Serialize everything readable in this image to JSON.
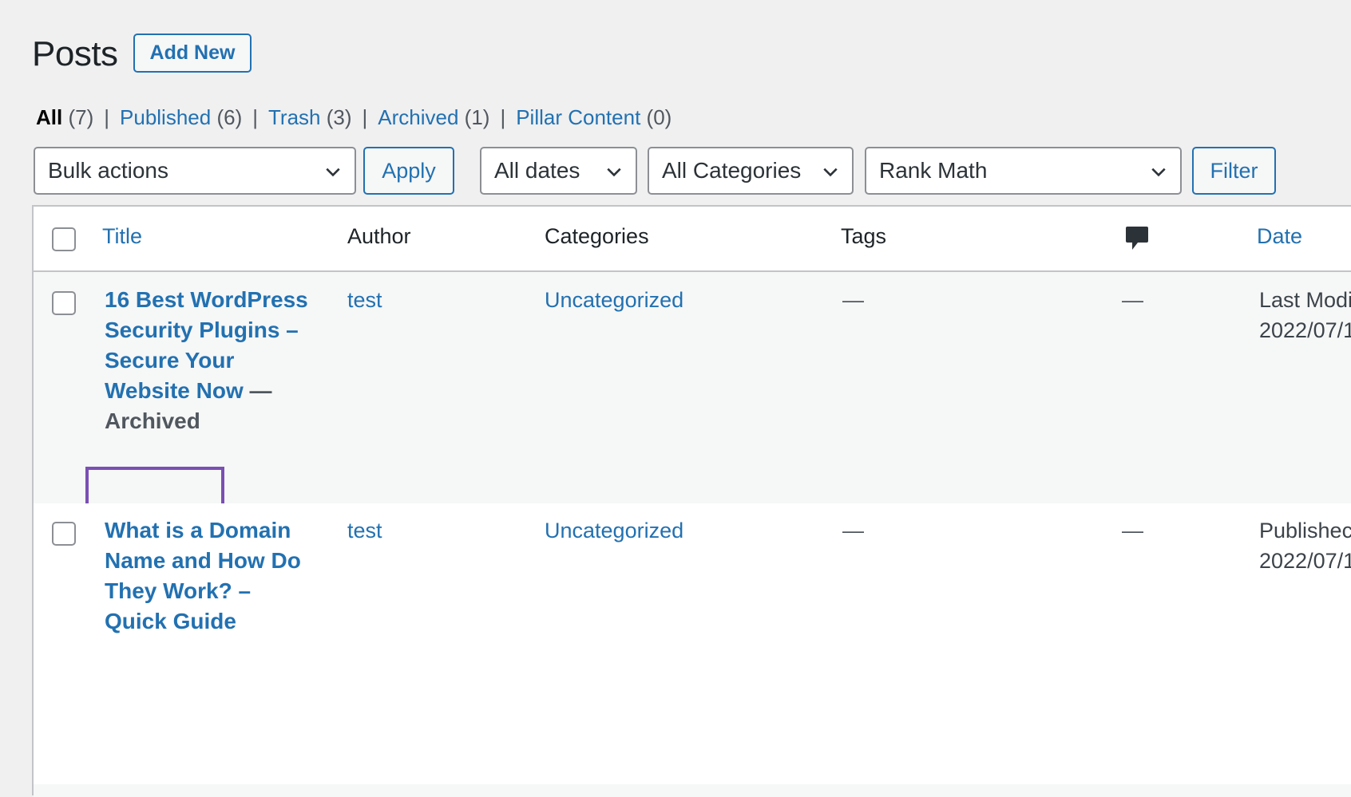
{
  "header": {
    "title": "Posts",
    "add_new_label": "Add New"
  },
  "views": [
    {
      "label": "All",
      "count": "(7)"
    },
    {
      "label": "Published",
      "count": "(6)"
    },
    {
      "label": "Trash",
      "count": "(3)"
    },
    {
      "label": "Archived",
      "count": "(1)"
    },
    {
      "label": "Pillar Content",
      "count": "(0)"
    }
  ],
  "views_separator": "|",
  "toolbar": {
    "bulk_actions": "Bulk actions",
    "apply_label": "Apply",
    "dates": "All dates",
    "categories": "All Categories",
    "rank_math": "Rank Math",
    "filter_label": "Filter"
  },
  "columns": {
    "title": "Title",
    "author": "Author",
    "categories": "Categories",
    "tags": "Tags",
    "comments_icon": "comment-bubble-icon",
    "date": "Date"
  },
  "rows": [
    {
      "title_lines": [
        "16 Best WordPress",
        "Security Plugins –",
        "Secure Your",
        "Website Now"
      ],
      "state_separator": " —",
      "state": "Archived",
      "author": "test",
      "category": "Uncategorized",
      "tags": "—",
      "comments": "—",
      "date_status": "Last Modi",
      "date_value": "2022/07/1"
    },
    {
      "title_lines": [
        "What is a Domain",
        "Name and How Do",
        "They Work? –",
        "Quick Guide"
      ],
      "author": "test",
      "category": "Uncategorized",
      "tags": "—",
      "comments": "—",
      "date_status": "Publishec",
      "date_value": "2022/07/1"
    }
  ],
  "colors": {
    "link": "#2271b1",
    "background": "#f0f0f1",
    "highlight": "#7b4fb3"
  }
}
